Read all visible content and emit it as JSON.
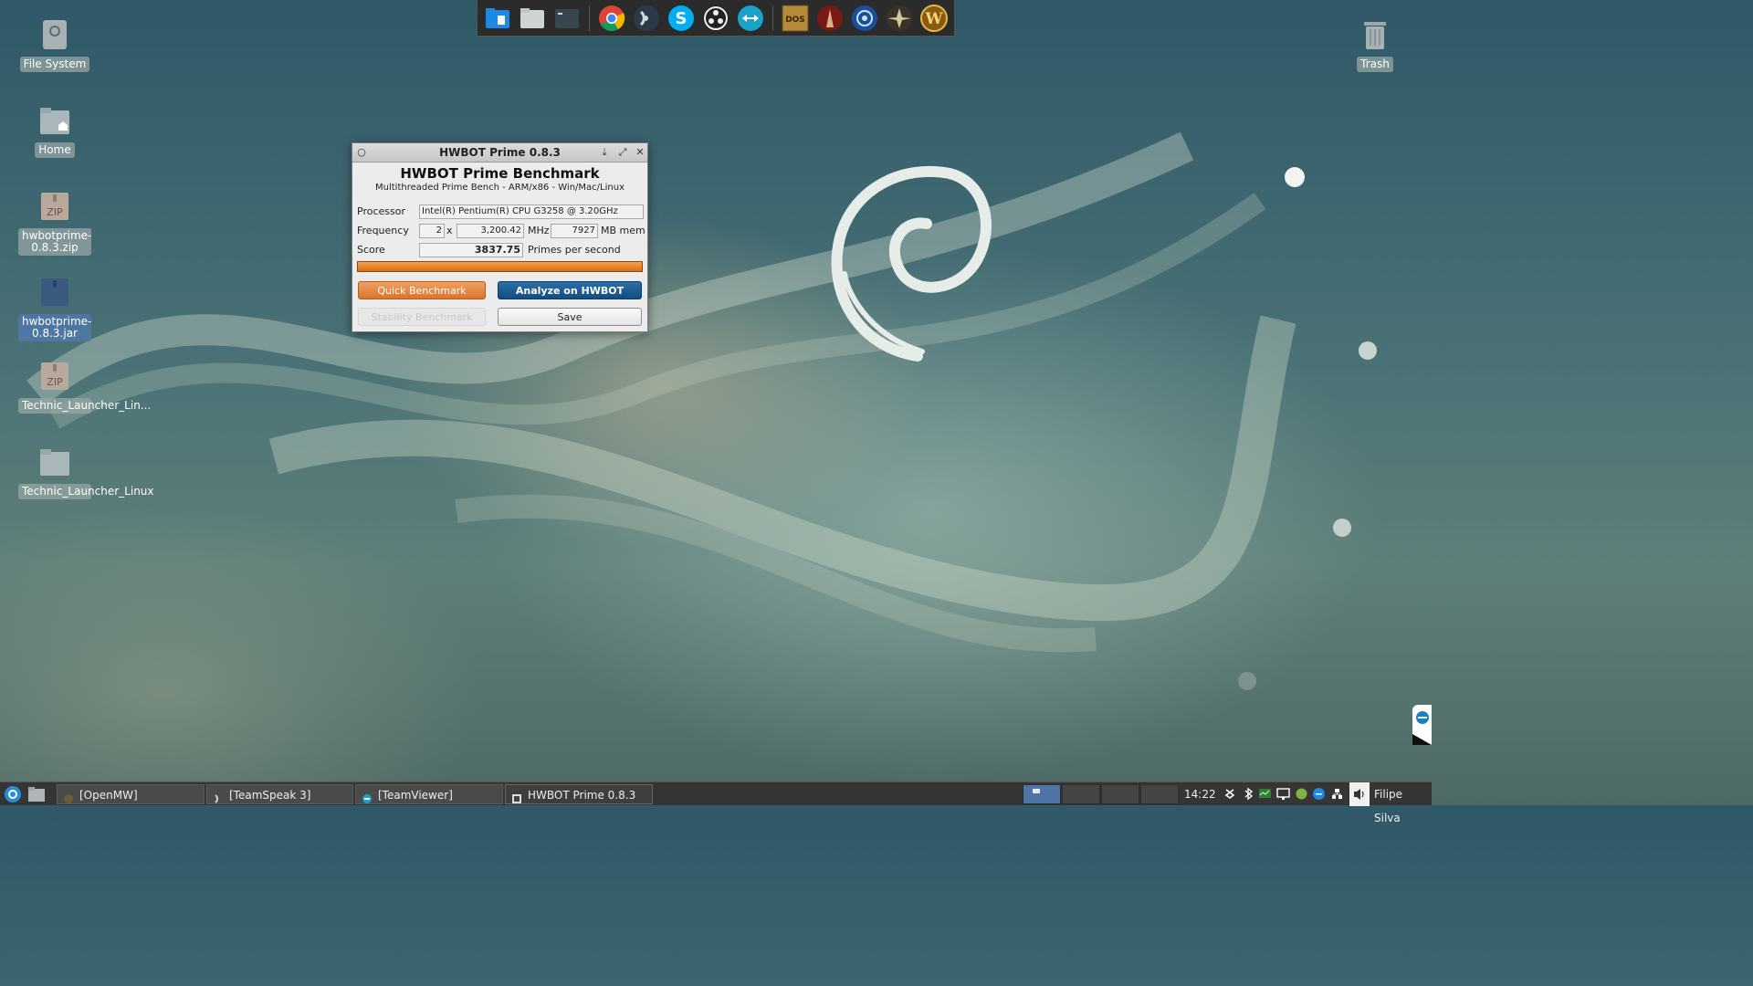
{
  "desktop": {
    "icons_left": [
      {
        "label": "File System",
        "icon": "drive-icon"
      },
      {
        "label": "Home",
        "icon": "home-folder-icon"
      },
      {
        "label": "hwbotprime-0.8.3.zip",
        "icon": "zip-icon"
      },
      {
        "label": "hwbotprime-0.8.3.jar",
        "icon": "jar-icon"
      },
      {
        "label": "Technic_Launcher_Lin...",
        "icon": "zip-icon"
      },
      {
        "label": "Technic_Launcher_Linux",
        "icon": "folder-icon"
      }
    ],
    "trash_label": "Trash"
  },
  "dock": {
    "items": [
      "file-manager-icon",
      "folder-icon",
      "terminal-icon",
      "chrome-icon",
      "teamspeak-icon",
      "skype-icon",
      "obs-icon",
      "teamviewer-icon",
      "dosbox-icon",
      "diablo-icon",
      "battlenet-icon",
      "game-icon",
      "wow-icon"
    ]
  },
  "window": {
    "title": "HWBOT Prime 0.8.3",
    "heading": "HWBOT Prime Benchmark",
    "subheading": "Multithreaded Prime Bench - ARM/x86 - Win/Mac/Linux",
    "processor_label": "Processor",
    "processor_value": "Intel(R) Pentium(R) CPU G3258 @ 3.20GHz",
    "frequency_label": "Frequency",
    "cores": "2",
    "times": "x",
    "mhz_value": "3,200.42",
    "mhz_unit": "MHz",
    "mem_value": "7927",
    "mem_unit": "MB mem",
    "score_label": "Score",
    "score_value": "3837.75",
    "score_unit": "Primes per second",
    "progress": 1.0,
    "quick_benchmark": "Quick Benchmark",
    "analyze": "Analyze on HWBOT",
    "stability_benchmark": "Stability Benchmark",
    "save": "Save"
  },
  "taskbar": {
    "tasks": [
      "[OpenMW]",
      "[TeamSpeak 3]",
      "[TeamViewer]",
      "HWBOT Prime 0.8.3"
    ],
    "clock": "14:22",
    "user": "Filipe Silva"
  },
  "colors": {
    "accent_orange": "#d9752e",
    "accent_blue": "#144d80"
  }
}
